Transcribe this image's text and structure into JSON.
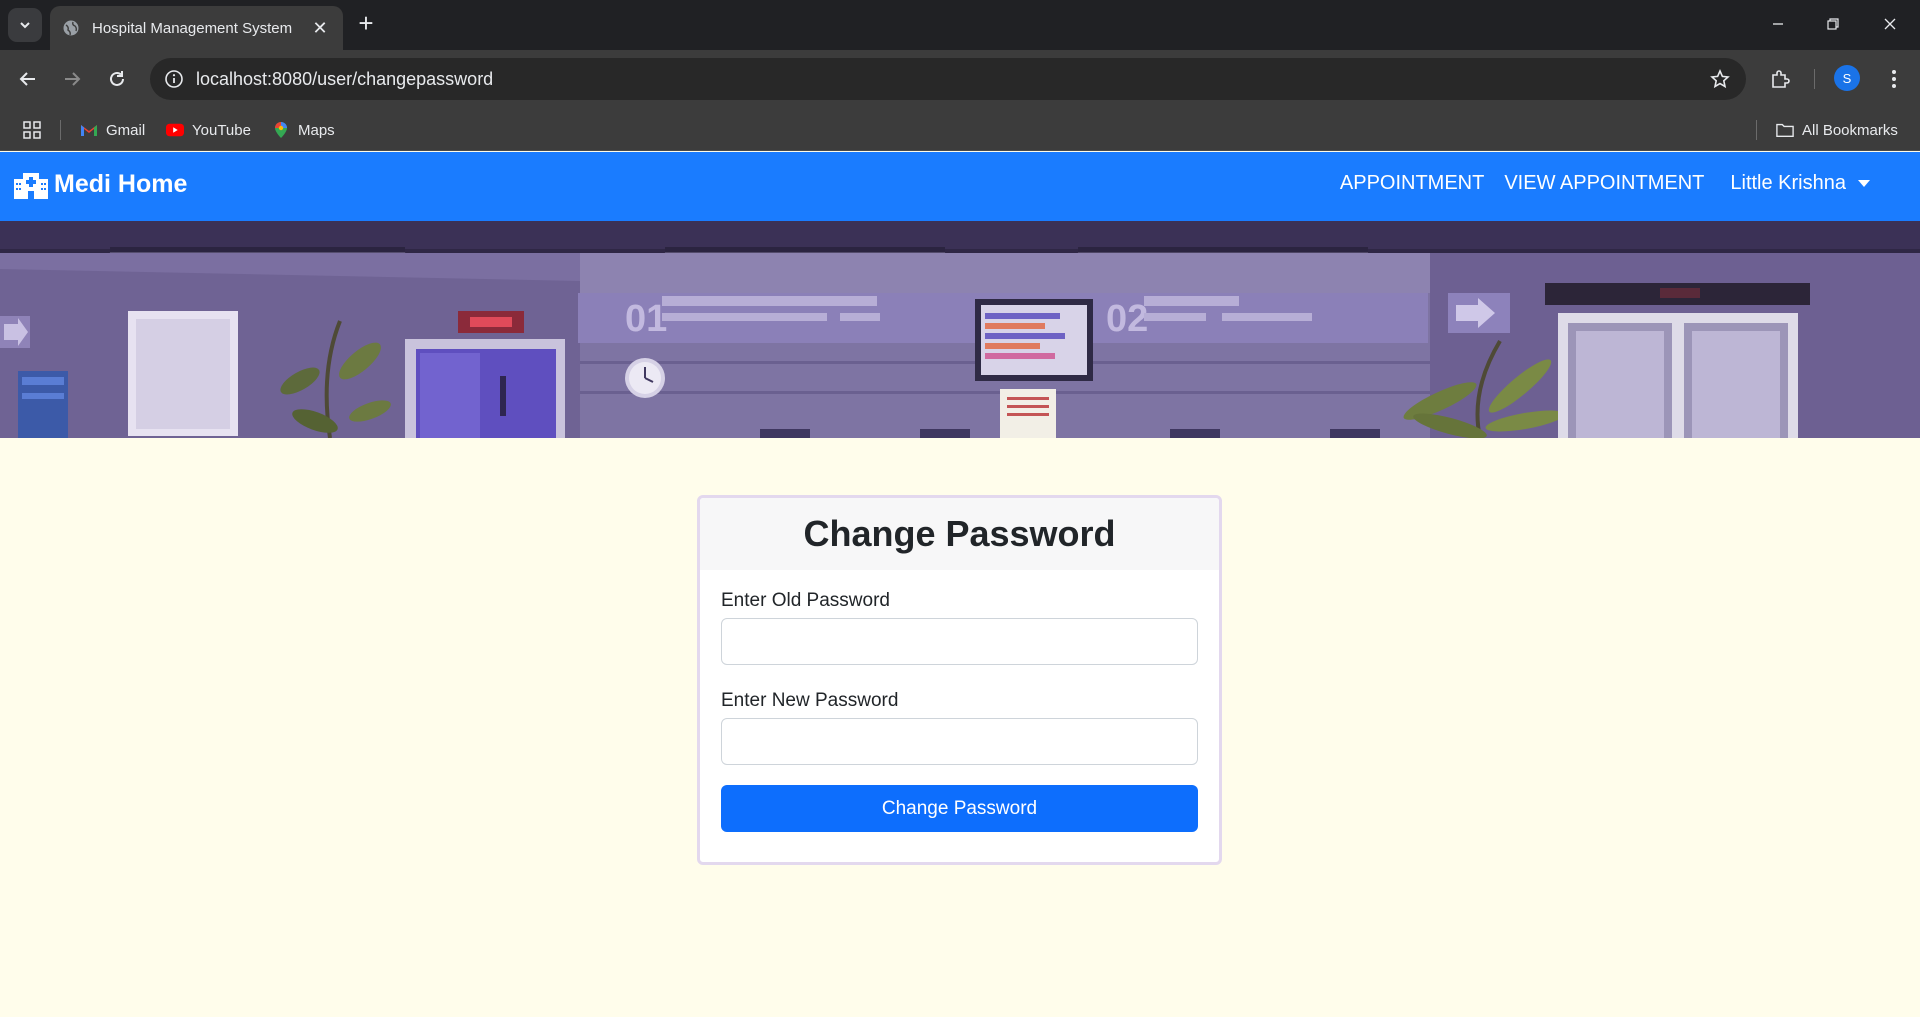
{
  "browser": {
    "tab_title": "Hospital Management System",
    "url": "localhost:8080/user/changepassword",
    "profile_initial": "S",
    "bookmarks": [
      {
        "label": "Gmail",
        "icon": "gmail-icon"
      },
      {
        "label": "YouTube",
        "icon": "youtube-icon"
      },
      {
        "label": "Maps",
        "icon": "maps-icon"
      }
    ],
    "all_bookmarks_label": "All Bookmarks"
  },
  "navbar": {
    "brand": "Medi Home",
    "links": [
      "APPOINTMENT",
      "VIEW APPOINTMENT"
    ],
    "user": "Little Krishna",
    "color": "#1a7cff"
  },
  "banner": {
    "counter_labels": [
      "01",
      "02"
    ]
  },
  "form": {
    "title": "Change Password",
    "old_password_label": "Enter Old Password",
    "old_password_value": "",
    "new_password_label": "Enter New Password",
    "new_password_value": "",
    "submit_label": "Change Password",
    "button_color": "#0d6efd"
  },
  "page_background": "#fffdeb"
}
